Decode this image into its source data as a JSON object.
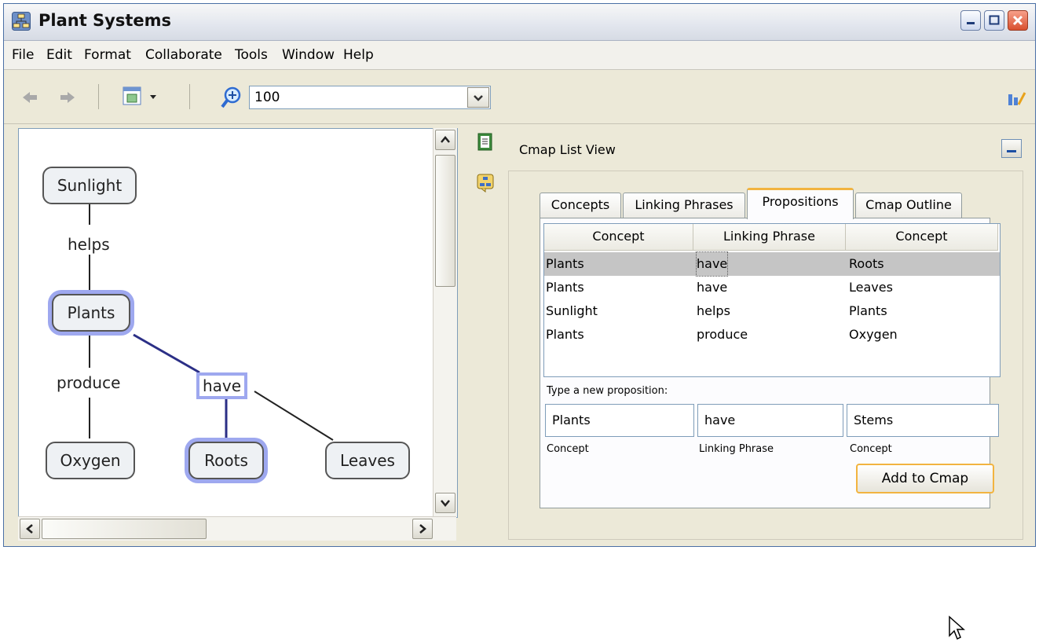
{
  "window": {
    "title": "Plant Systems"
  },
  "menu": [
    "File",
    "Edit",
    "Format",
    "Collaborate",
    "Tools",
    "Window",
    "Help"
  ],
  "toolbar": {
    "zoom_value": "100"
  },
  "cmap": {
    "nodes": {
      "sunlight": "Sunlight",
      "plants": "Plants",
      "oxygen": "Oxygen",
      "roots": "Roots",
      "leaves": "Leaves"
    },
    "links": {
      "helps": "helps",
      "produce": "produce",
      "have": "have"
    }
  },
  "panel": {
    "title": "Cmap List View",
    "tabs": [
      "Concepts",
      "Linking Phrases",
      "Propositions",
      "Cmap Outline"
    ],
    "active_tab": "Propositions",
    "columns": [
      "Concept",
      "Linking Phrase",
      "Concept"
    ],
    "rows": [
      [
        "Plants",
        "have",
        "Roots"
      ],
      [
        "Plants",
        "have",
        "Leaves"
      ],
      [
        "Sunlight",
        "helps",
        "Plants"
      ],
      [
        "Plants",
        "produce",
        "Oxygen"
      ]
    ],
    "new_prop_label": "Type a new proposition:",
    "inputs": [
      "Plants",
      "have",
      "Stems"
    ],
    "captions": [
      "Concept",
      "Linking Phrase",
      "Concept"
    ],
    "add_button": "Add to Cmap"
  }
}
